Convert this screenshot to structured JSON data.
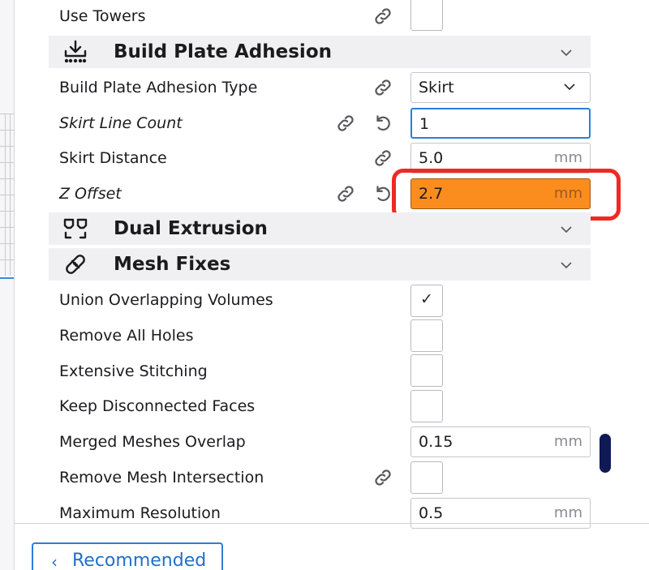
{
  "rows_top": {
    "use_towers": {
      "label": "Use Towers"
    }
  },
  "sections": {
    "adhesion": {
      "title": "Build Plate Adhesion",
      "icon": "build-plate-adhesion-icon"
    },
    "dual": {
      "title": "Dual Extrusion",
      "icon": "dual-extrusion-icon"
    },
    "mesh": {
      "title": "Mesh Fixes",
      "icon": "mesh-fixes-icon"
    }
  },
  "adhesion": {
    "type": {
      "label": "Build Plate Adhesion Type",
      "value": "Skirt"
    },
    "skirt_line_count": {
      "label": "Skirt Line Count",
      "value": "1"
    },
    "skirt_distance": {
      "label": "Skirt Distance",
      "value": "5.0",
      "unit": "mm"
    },
    "z_offset": {
      "label": "Z Offset",
      "value": "2.7",
      "unit": "mm"
    }
  },
  "mesh": {
    "union": {
      "label": "Union Overlapping Volumes",
      "checked": true,
      "check_glyph": "✓"
    },
    "remove_holes": {
      "label": "Remove All Holes",
      "checked": false
    },
    "extensive": {
      "label": "Extensive Stitching",
      "checked": false
    },
    "keep_disconnected": {
      "label": "Keep Disconnected Faces",
      "checked": false
    },
    "merged_overlap": {
      "label": "Merged Meshes Overlap",
      "value": "0.15",
      "unit": "mm"
    },
    "remove_intersection": {
      "label": "Remove Mesh Intersection",
      "checked": false
    },
    "max_resolution": {
      "label": "Maximum Resolution",
      "value": "0.5",
      "unit": "mm"
    }
  },
  "footer": {
    "recommended_label": "Recommended",
    "chevron": "‹"
  },
  "colors": {
    "highlight": "#fb8d1f",
    "annotation": "#ee2a22",
    "accent": "#2b7fd9",
    "scrollbar": "#0f1a55"
  }
}
